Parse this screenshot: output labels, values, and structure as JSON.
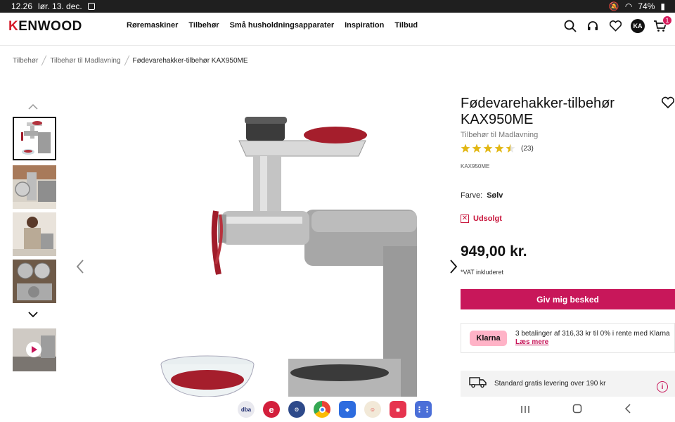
{
  "status_bar": {
    "time": "12.26",
    "date": "lør. 13. dec.",
    "battery": "74%"
  },
  "header": {
    "logo": "KENWOOD",
    "nav": [
      "Røremaskiner",
      "Tilbehør",
      "Små husholdningsapparater",
      "Inspiration",
      "Tilbud"
    ],
    "avatar_initials": "KA",
    "cart_count": "1"
  },
  "breadcrumb": [
    "Tilbehør",
    "Tilbehør til Madlavning",
    "Fødevarehakker-tilbehør KAX950ME"
  ],
  "product": {
    "title": "Fødevarehakker-tilbehør KAX950ME",
    "category": "Tilbehør til Madlavning",
    "rating": 4.5,
    "reviews": "(23)",
    "sku": "KAX950ME",
    "color_label": "Farve:",
    "color_value": "Sølv",
    "availability": "Udsolgt",
    "price": "949,00 kr.",
    "vat_note": "*VAT inkluderet",
    "notify_button": "Giv mig besked"
  },
  "klarna": {
    "logo": "Klarna",
    "text": "3 betalinger af 316,33 kr til 0% i rente med Klarna",
    "link": "Læs mere"
  },
  "delivery": {
    "text": "Standard gratis levering over 190 kr"
  },
  "dock": {
    "apps": [
      "dba",
      "e"
    ]
  },
  "colors": {
    "brand_red": "#d51c2a",
    "accent_pink": "#c8175a",
    "klarna_pink": "#ffb3c7"
  }
}
